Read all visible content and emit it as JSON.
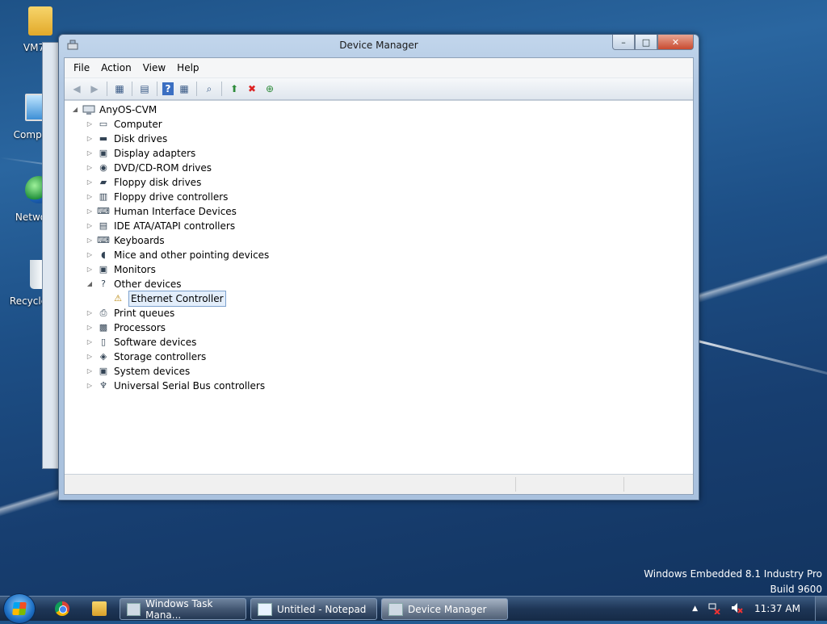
{
  "desktop": {
    "icons": [
      {
        "label": "VM7",
        "icon": "user-folder-icon"
      },
      {
        "label": "Compu",
        "icon": "computer-icon"
      },
      {
        "label": "Netwo",
        "icon": "network-icon"
      },
      {
        "label": "Recycle",
        "icon": "recycle-bin-icon"
      }
    ]
  },
  "window": {
    "title": "Device Manager",
    "controls": {
      "minimize": "–",
      "maximize": "□",
      "close": "✕"
    },
    "menu": [
      "File",
      "Action",
      "View",
      "Help"
    ],
    "toolbar": [
      "back",
      "forward",
      "show-hide-tree",
      "properties",
      "help",
      "view",
      "scan-hardware",
      "update-driver",
      "uninstall",
      "enable"
    ]
  },
  "tree": {
    "root": "AnyOS-CVM",
    "categories": [
      {
        "label": "Computer",
        "icon": "computer-icon",
        "expanded": false
      },
      {
        "label": "Disk drives",
        "icon": "disk-icon",
        "expanded": false
      },
      {
        "label": "Display adapters",
        "icon": "display-adapter-icon",
        "expanded": false
      },
      {
        "label": "DVD/CD-ROM drives",
        "icon": "dvd-icon",
        "expanded": false
      },
      {
        "label": "Floppy disk drives",
        "icon": "floppy-icon",
        "expanded": false
      },
      {
        "label": "Floppy drive controllers",
        "icon": "floppy-controller-icon",
        "expanded": false
      },
      {
        "label": "Human Interface Devices",
        "icon": "hid-icon",
        "expanded": false
      },
      {
        "label": "IDE ATA/ATAPI controllers",
        "icon": "ide-icon",
        "expanded": false
      },
      {
        "label": "Keyboards",
        "icon": "keyboard-icon",
        "expanded": false
      },
      {
        "label": "Mice and other pointing devices",
        "icon": "mouse-icon",
        "expanded": false
      },
      {
        "label": "Monitors",
        "icon": "monitor-icon",
        "expanded": false
      },
      {
        "label": "Other devices",
        "icon": "unknown-device-icon",
        "expanded": true,
        "children": [
          {
            "label": "Ethernet Controller",
            "icon": "warning-device-icon",
            "selected": true
          }
        ]
      },
      {
        "label": "Print queues",
        "icon": "printer-icon",
        "expanded": false
      },
      {
        "label": "Processors",
        "icon": "processor-icon",
        "expanded": false
      },
      {
        "label": "Software devices",
        "icon": "software-device-icon",
        "expanded": false
      },
      {
        "label": "Storage controllers",
        "icon": "storage-controller-icon",
        "expanded": false
      },
      {
        "label": "System devices",
        "icon": "system-device-icon",
        "expanded": false
      },
      {
        "label": "Universal Serial Bus controllers",
        "icon": "usb-icon",
        "expanded": false
      }
    ]
  },
  "watermark": {
    "line1": "Windows Embedded 8.1 Industry Pro",
    "line2": "Build 9600"
  },
  "taskbar": {
    "tasks": [
      {
        "label": "Windows Task Mana...",
        "active": false
      },
      {
        "label": "Untitled - Notepad",
        "active": false
      },
      {
        "label": "Device Manager",
        "active": true
      }
    ],
    "tray_arrow": "▲",
    "clock": "11:37 AM"
  }
}
